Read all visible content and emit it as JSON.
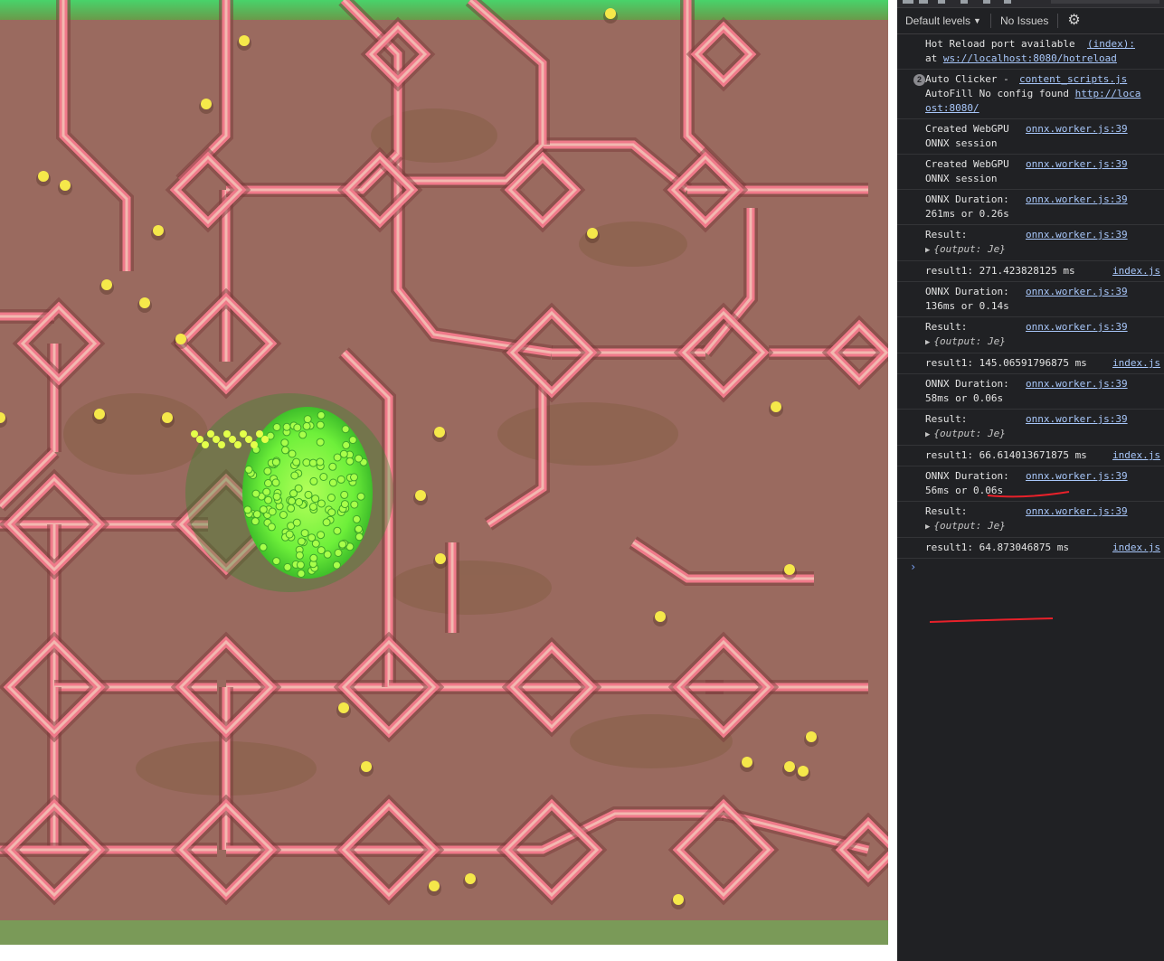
{
  "devtools": {
    "levels_label": "Default levels",
    "issues_label": "No Issues",
    "messages": [
      {
        "line1": "Hot Reload port available",
        "line2": "at ws://localhost:8080/hotreload",
        "source": "(index):"
      },
      {
        "count": "2",
        "line1": "Auto Clicker -",
        "line2": "AutoFill No config found http://loca",
        "line3": "ost:8080/",
        "source": "content_scripts.js"
      },
      {
        "line1": "Created WebGPU",
        "line2": "ONNX session",
        "source": "onnx.worker.js:39"
      },
      {
        "line1": "Created WebGPU",
        "line2": "ONNX session",
        "source": "onnx.worker.js:39"
      },
      {
        "line1": "ONNX Duration:",
        "line2": "261ms or 0.26s",
        "source": "onnx.worker.js:39"
      },
      {
        "line1": "Result:",
        "object": "{output: Je}",
        "source": "onnx.worker.js:39"
      },
      {
        "line1": "result1: 271.423828125 ms",
        "source": "index.js"
      },
      {
        "line1": "ONNX Duration:",
        "line2": "136ms or 0.14s",
        "source": "onnx.worker.js:39"
      },
      {
        "line1": "Result:",
        "object": "{output: Je}",
        "source": "onnx.worker.js:39"
      },
      {
        "line1": "result1: 145.06591796875 ms",
        "source": "index.js"
      },
      {
        "line1": "ONNX Duration:",
        "line2": "58ms or 0.06s",
        "source": "onnx.worker.js:39"
      },
      {
        "line1": "Result:",
        "object": "{output: Je}",
        "source": "onnx.worker.js:39"
      },
      {
        "line1": "result1: 66.614013671875 ms",
        "source": "index.js"
      },
      {
        "line1": "ONNX Duration:",
        "line2": "56ms or 0.06s",
        "source": "onnx.worker.js:39"
      },
      {
        "line1": "Result:",
        "object": "{output: Je}",
        "source": "onnx.worker.js:39"
      },
      {
        "line1": "result1: 64.873046875 ms",
        "source": "index.js"
      }
    ],
    "prompt": "›"
  },
  "colors": {
    "canvas_bg": "#9a6a5f",
    "wall": "#f07a8a",
    "wall_light": "#f2b8b0",
    "blob": "#7dff3a",
    "dot": "#f5e84a",
    "annotation": "#e8212a"
  }
}
